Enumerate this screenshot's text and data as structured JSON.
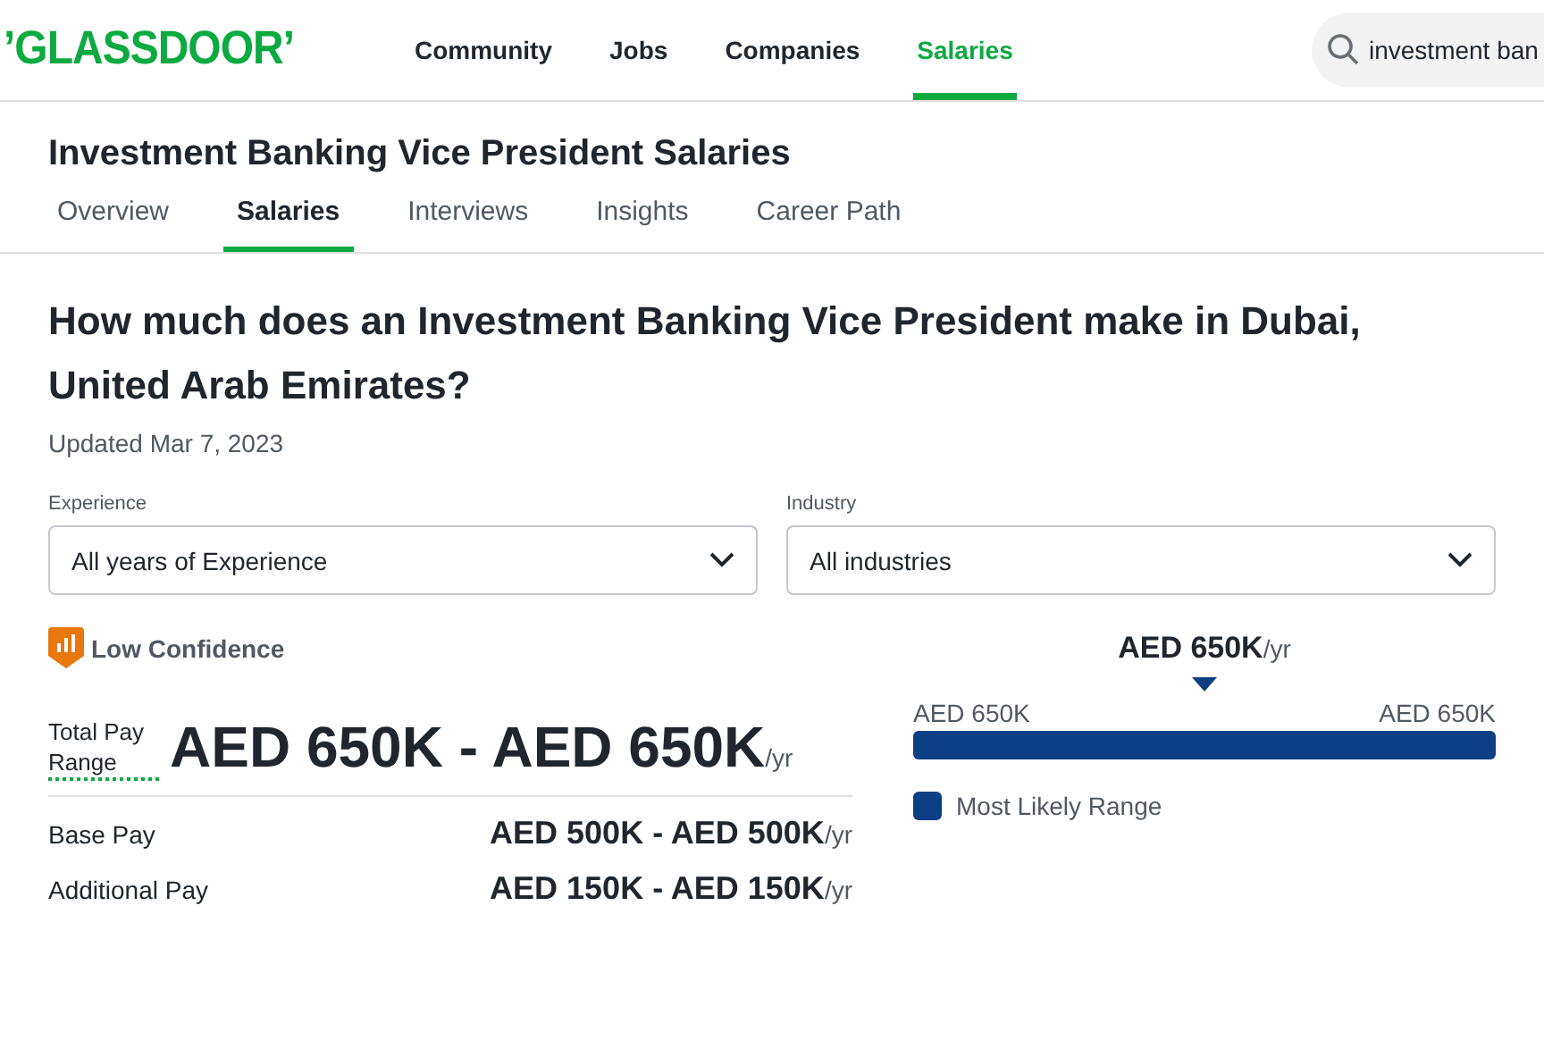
{
  "header": {
    "logo": "’GLASSDOOR’",
    "nav": [
      {
        "label": "Community",
        "selected": false
      },
      {
        "label": "Jobs",
        "selected": false
      },
      {
        "label": "Companies",
        "selected": false
      },
      {
        "label": "Salaries",
        "selected": true
      }
    ],
    "search": {
      "value": "investment ban"
    }
  },
  "page_title": "Investment Banking Vice President Salaries",
  "tabs": [
    {
      "label": "Overview",
      "selected": false
    },
    {
      "label": "Salaries",
      "selected": true
    },
    {
      "label": "Interviews",
      "selected": false
    },
    {
      "label": "Insights",
      "selected": false
    },
    {
      "label": "Career Path",
      "selected": false
    }
  ],
  "question": "How much does an Investment Banking Vice President make in Dubai, United Arab Emirates?",
  "updated": "Updated Mar 7, 2023",
  "filters": [
    {
      "label": "Experience",
      "value": "All years of Experience"
    },
    {
      "label": "Industry",
      "value": "All industries"
    }
  ],
  "confidence": {
    "label": "Low Confidence"
  },
  "total_pay": {
    "label": "Total Pay Range",
    "value": "AED 650K - AED 650K",
    "unit": "/yr"
  },
  "pay_rows": [
    {
      "label": "Base Pay",
      "value": "AED 500K - AED 500K",
      "unit": "/yr"
    },
    {
      "label": "Additional Pay",
      "value": "AED 150K - AED 150K",
      "unit": "/yr"
    }
  ],
  "range_chart": {
    "median": "AED 650K",
    "median_unit": "/yr",
    "min": "AED 650K",
    "max": "AED 650K",
    "legend": "Most Likely Range"
  }
}
